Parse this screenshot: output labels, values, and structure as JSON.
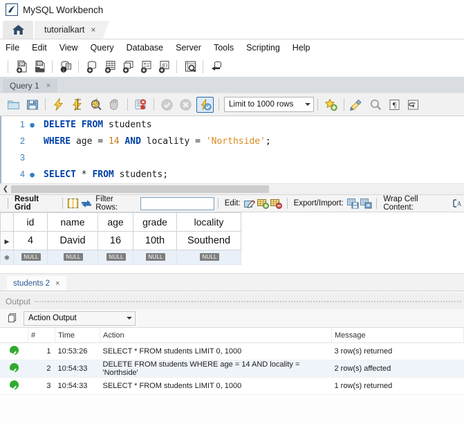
{
  "window": {
    "title": "MySQL Workbench",
    "icon": "workbench-logo-icon"
  },
  "tabs": {
    "home_icon": "home-icon",
    "document": {
      "label": "tutorialkart",
      "close": "×"
    }
  },
  "menu": {
    "items": [
      "File",
      "Edit",
      "View",
      "Query",
      "Database",
      "Server",
      "Tools",
      "Scripting",
      "Help"
    ]
  },
  "main_toolbar": {
    "icons": [
      "new-sql-tab-icon",
      "open-sql-script-icon",
      "open-connection-info-icon",
      "new-schema-icon",
      "new-table-icon",
      "new-view-icon",
      "new-procedure-icon",
      "new-function-icon",
      "search-data-icon",
      "reconnect-dbms-icon"
    ]
  },
  "query_tab": {
    "label": "Query 1",
    "close": "×"
  },
  "query_toolbar": {
    "icons": [
      "open-script-icon",
      "save-script-icon",
      "execute-statement-icon",
      "execute-current-statement-icon",
      "explain-query-icon",
      "stop-query-icon",
      "toggle-stop-on-error-icon",
      "commit-transaction-icon",
      "rollback-transaction-icon",
      "toggle-autocommit-icon"
    ],
    "limit_select": {
      "value": "Limit to 1000 rows"
    },
    "right_icons": [
      "toggle-snippets-icon",
      "beautify-sql-icon",
      "find-icon",
      "toggle-invisible-chars-icon",
      "toggle-wordwrap-icon"
    ]
  },
  "editor": {
    "lines": [
      {
        "number": "1",
        "breakpoint": true,
        "tokens": [
          {
            "t": "DELETE",
            "c": "kw"
          },
          {
            "t": " ",
            "c": "plain"
          },
          {
            "t": "FROM",
            "c": "kw"
          },
          {
            "t": " students",
            "c": "plain"
          }
        ]
      },
      {
        "number": "2",
        "breakpoint": false,
        "tokens": [
          {
            "t": "WHERE",
            "c": "kw"
          },
          {
            "t": " age = ",
            "c": "plain"
          },
          {
            "t": "14",
            "c": "num"
          },
          {
            "t": " ",
            "c": "plain"
          },
          {
            "t": "AND",
            "c": "kw"
          },
          {
            "t": " locality = ",
            "c": "plain"
          },
          {
            "t": "'Northside'",
            "c": "str"
          },
          {
            "t": ";",
            "c": "plain"
          }
        ]
      },
      {
        "number": "3",
        "breakpoint": false,
        "tokens": []
      },
      {
        "number": "4",
        "breakpoint": true,
        "tokens": [
          {
            "t": "SELECT",
            "c": "kw"
          },
          {
            "t": " * ",
            "c": "plain"
          },
          {
            "t": "FROM",
            "c": "kw"
          },
          {
            "t": " students;",
            "c": "plain"
          }
        ]
      }
    ]
  },
  "result_toolbar": {
    "title": "Result Grid",
    "grid_view_icon": "grid-view-icon",
    "refresh_icon": "refresh-icon",
    "filter_label": "Filter Rows:",
    "filter_value": "",
    "filter_placeholder": "",
    "edit_label": "Edit:",
    "edit_icons": [
      "edit-cell-icon",
      "insert-row-icon",
      "delete-row-icon"
    ],
    "export_label": "Export/Import:",
    "export_icons": [
      "export-recordset-icon",
      "import-recordset-icon"
    ],
    "wrap_label": "Wrap Cell Content:",
    "wrap_icon": "wrap-cell-icon"
  },
  "result_grid": {
    "columns": [
      "id",
      "name",
      "age",
      "grade",
      "locality"
    ],
    "rows": [
      {
        "marker": "▶",
        "cells": [
          "4",
          "David",
          "16",
          "10th",
          "Southend"
        ]
      }
    ],
    "null_row": {
      "marker": "✱",
      "placeholder": "NULL"
    }
  },
  "result_tabs": [
    {
      "label": "students 2",
      "close": "×"
    }
  ],
  "output": {
    "panel_title": "Output",
    "selector_icon": "output-pages-icon",
    "selector_value": "Action Output",
    "columns": [
      "#",
      "Time",
      "Action",
      "Message"
    ],
    "rows": [
      {
        "status": "success",
        "num": "1",
        "time": "10:53:26",
        "action": "SELECT * FROM students LIMIT 0, 1000",
        "message": "3 row(s) returned"
      },
      {
        "status": "success",
        "num": "2",
        "time": "10:54:33",
        "action": "DELETE FROM students WHERE age = 14 AND locality = 'Northside'",
        "message": "2 row(s) affected"
      },
      {
        "status": "success",
        "num": "3",
        "time": "10:54:33",
        "action": "SELECT * FROM students LIMIT 0, 1000",
        "message": "1 row(s) returned"
      }
    ]
  },
  "colors": {
    "keyword": "#0041a8",
    "number": "#c07a19",
    "string": "#d98c1f",
    "accent": "#2d6ca8",
    "success": "#2faa2f",
    "tab_link": "#2a5b96"
  }
}
